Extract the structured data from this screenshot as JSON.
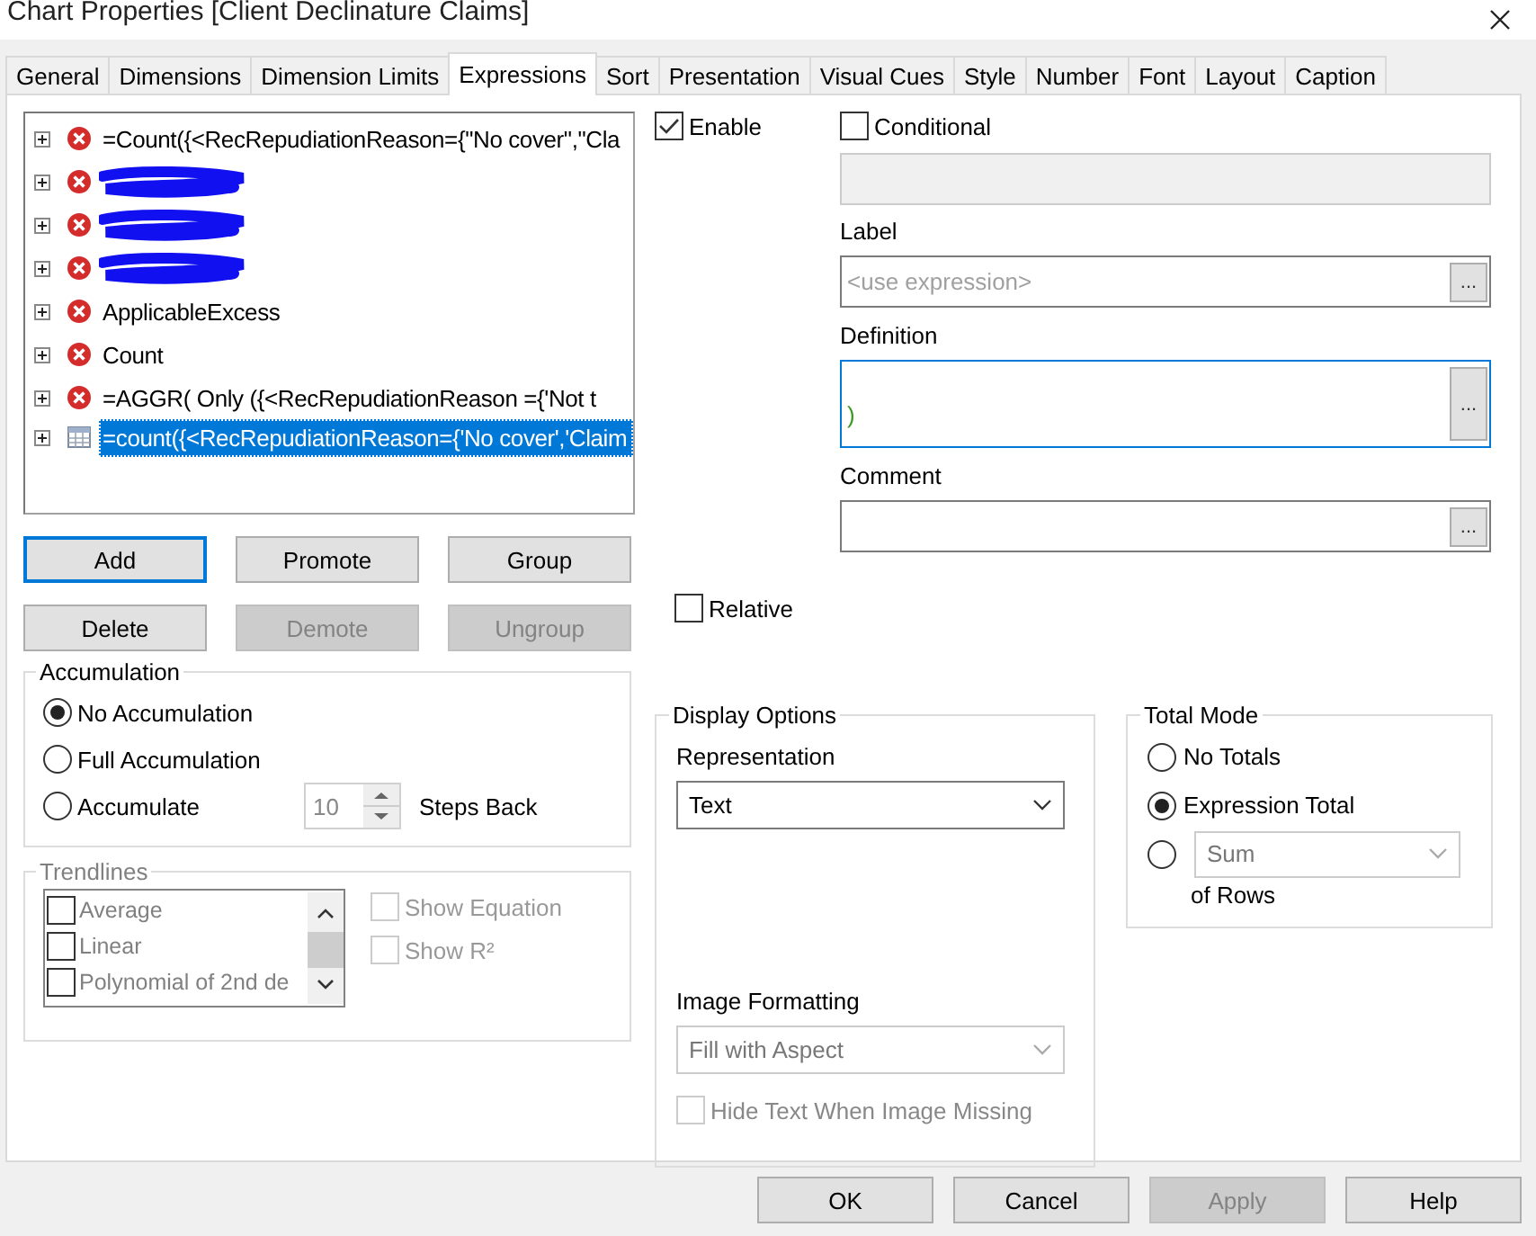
{
  "window": {
    "title": "Chart Properties [Client Declinature Claims]"
  },
  "tabs": [
    {
      "label": "General",
      "selected": false
    },
    {
      "label": "Dimensions",
      "selected": false
    },
    {
      "label": "Dimension Limits",
      "selected": false
    },
    {
      "label": "Expressions",
      "selected": true
    },
    {
      "label": "Sort",
      "selected": false
    },
    {
      "label": "Presentation",
      "selected": false
    },
    {
      "label": "Visual Cues",
      "selected": false
    },
    {
      "label": "Style",
      "selected": false
    },
    {
      "label": "Number",
      "selected": false
    },
    {
      "label": "Font",
      "selected": false
    },
    {
      "label": "Layout",
      "selected": false
    },
    {
      "label": "Caption",
      "selected": false
    }
  ],
  "expressions": [
    {
      "kind": "error",
      "label": "=Count({<RecRepudiationReason={\"No  cover\",\"Cla",
      "redacted": false,
      "selected": false
    },
    {
      "kind": "error",
      "redacted": true,
      "selected": false
    },
    {
      "kind": "error",
      "redacted": true,
      "selected": false
    },
    {
      "kind": "error",
      "redacted": true,
      "selected": false
    },
    {
      "kind": "error",
      "label": "ApplicableExcess",
      "redacted": false,
      "selected": false
    },
    {
      "kind": "error",
      "label": "Count",
      "redacted": false,
      "selected": false
    },
    {
      "kind": "error",
      "label": "=AGGR(  Only  ({<RecRepudiationReason ={'Not  t",
      "redacted": false,
      "selected": false
    },
    {
      "kind": "table",
      "label": "=count({<RecRepudiationReason={'No  cover','Claim",
      "redacted": false,
      "selected": true
    }
  ],
  "expression_buttons": [
    {
      "label": "Add",
      "disabled": false,
      "focused": true
    },
    {
      "label": "Promote",
      "disabled": false,
      "focused": false
    },
    {
      "label": "Group",
      "disabled": false,
      "focused": false
    },
    {
      "label": "Delete",
      "disabled": false,
      "focused": false
    },
    {
      "label": "Demote",
      "disabled": true,
      "focused": false
    },
    {
      "label": "Ungroup",
      "disabled": true,
      "focused": false
    }
  ],
  "enable": {
    "label": "Enable",
    "checked": true
  },
  "conditional": {
    "label": "Conditional",
    "checked": false
  },
  "label_field": {
    "label": "Label",
    "placeholder": "<use expression>",
    "button": "..."
  },
  "definition_field": {
    "label": "Definition",
    "value": ")",
    "button": "..."
  },
  "comment_field": {
    "label": "Comment",
    "button": "..."
  },
  "relative": {
    "label": "Relative",
    "checked": false
  },
  "accumulation": {
    "title": "Accumulation",
    "options": [
      {
        "label": "No Accumulation",
        "selected": true
      },
      {
        "label": "Full Accumulation",
        "selected": false
      },
      {
        "label": "Accumulate",
        "selected": false
      }
    ],
    "steps_value": "10",
    "steps_label": "Steps Back"
  },
  "trendlines": {
    "title": "Trendlines",
    "disabled": true,
    "items": [
      {
        "label": "Average",
        "checked": false
      },
      {
        "label": "Linear",
        "checked": false
      },
      {
        "label": "Polynomial of 2nd de",
        "checked": false
      }
    ],
    "options": [
      {
        "label": "Show Equation",
        "checked": false
      },
      {
        "label": "Show R²",
        "checked": false
      }
    ]
  },
  "display_options": {
    "title": "Display Options",
    "representation": {
      "label": "Representation",
      "value": "Text",
      "disabled": false
    },
    "image_formatting": {
      "label": "Image Formatting",
      "value": "Fill with Aspect",
      "disabled": true
    },
    "hide_text": {
      "label": "Hide Text When Image Missing",
      "checked": false,
      "disabled": true
    }
  },
  "total_mode": {
    "title": "Total Mode",
    "options": [
      {
        "kind": "plain",
        "label": "No Totals",
        "selected": false
      },
      {
        "kind": "plain",
        "label": "Expression Total",
        "selected": true
      },
      {
        "kind": "function",
        "value": "Sum",
        "suffix": "of Rows",
        "selected": false
      }
    ]
  },
  "footer_buttons": [
    {
      "label": "OK",
      "disabled": false
    },
    {
      "label": "Cancel",
      "disabled": false
    },
    {
      "label": "Apply",
      "disabled": true
    },
    {
      "label": "Help",
      "disabled": false
    }
  ]
}
